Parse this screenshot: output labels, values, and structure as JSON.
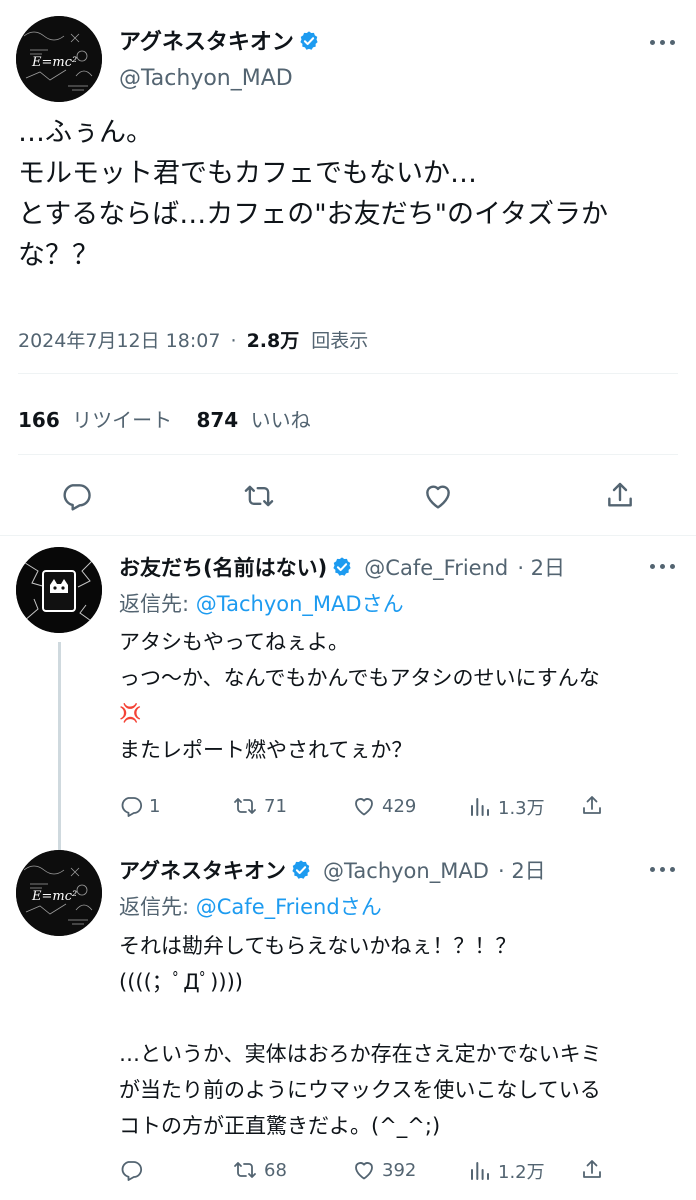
{
  "main_tweet": {
    "display_name": "アグネスタキオン",
    "handle": "@Tachyon_MAD",
    "lines": [
      "…ふぅん。",
      "モルモット君でもカフェでもないか…",
      "とするならば…カフェの\"お友だち\"のイタズラか",
      "な？？"
    ],
    "timestamp": "2024年7月12日 18:07",
    "separator": "·",
    "views_count": "2.8万",
    "views_label": "回表示",
    "retweets_count": "166",
    "retweets_label": "リツイート",
    "likes_count": "874",
    "likes_label": "いいね"
  },
  "replies": [
    {
      "display_name": "お友だち(名前はない)",
      "handle": "@Cafe_Friend",
      "time": "· 2日",
      "reply_prefix": "返信先: ",
      "reply_to": "@Tachyon_MADさん",
      "lines": [
        "アタシもやってねぇよ。",
        "っつ〜か、なんでもかんでもアタシのせいにすんな",
        "💢",
        "またレポート燃やされてぇか？"
      ],
      "replies": "1",
      "retweets": "71",
      "likes": "429",
      "views": "1.3万"
    },
    {
      "display_name": "アグネスタキオン",
      "handle": "@Tachyon_MAD",
      "time": "· 2日",
      "reply_prefix": "返信先: ",
      "reply_to": "@Cafe_Friendさん",
      "lines": [
        "それは勘弁してもらえないかねぇ！？！？",
        "((((；ﾟДﾟ))))",
        "",
        "…というか、実体はおろか存在さえ定かでないキミ",
        "が当たり前のようにウマックスを使いこなしている",
        "コトの方が正直驚きだよ。(^_^;)"
      ],
      "replies": "",
      "retweets": "68",
      "likes": "392",
      "views": "1.2万"
    }
  ],
  "colors": {
    "verified": "#1d9bf0",
    "link": "#1d9bf0",
    "secondary": "#536471",
    "divider": "#eff3f4"
  },
  "icons": [
    "verified-badge-icon",
    "more-icon",
    "reply-icon",
    "retweet-icon",
    "like-icon",
    "share-icon",
    "views-icon",
    "anger-emoji-icon"
  ]
}
